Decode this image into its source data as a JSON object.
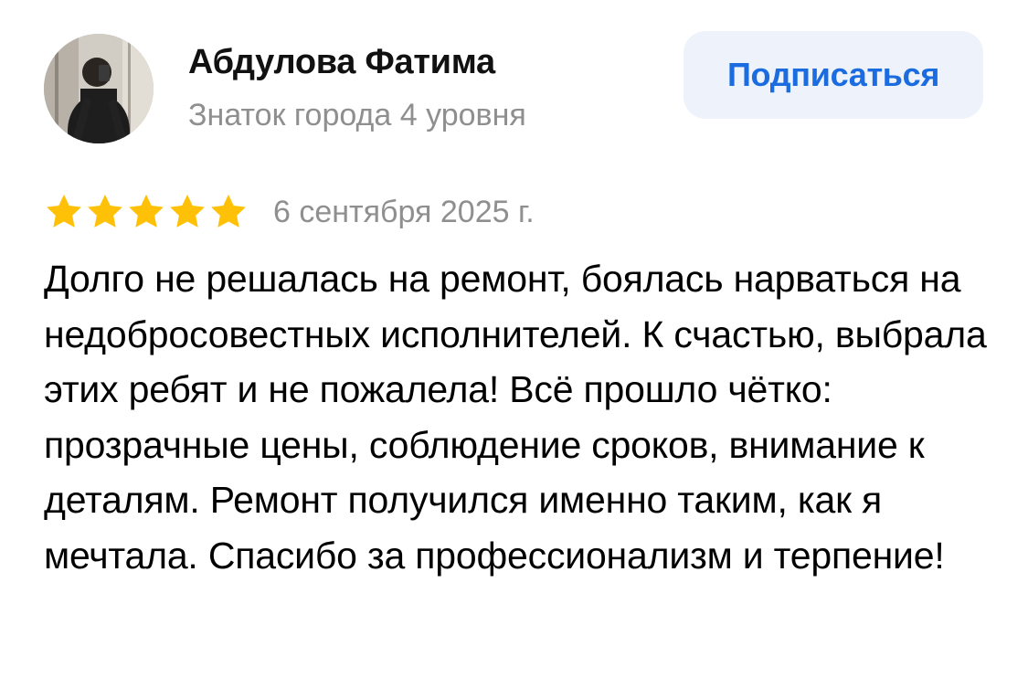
{
  "author": {
    "name": "Абдулова Фатима",
    "level": "Знаток города 4 уровня",
    "avatar": "user-avatar-photo"
  },
  "actions": {
    "subscribe_label": "Подписаться"
  },
  "review": {
    "rating": 5,
    "rating_max": 5,
    "date": "6 сентября 2025 г.",
    "text": "Долго не решалась на ремонт, боялась нарваться на недобросовестных исполнителей. К счастью, выбрала этих ребят и не пожалела! Всё прошло чётко: прозрачные цены, соблюдение сроков, внимание к деталям. Ремонт получился именно таким, как я мечтала. Спасибо за профессионализм и терпение!"
  },
  "colors": {
    "accent": "#1a6ce0",
    "button_bg": "#eef3fb",
    "star": "#ffc107",
    "muted_text": "#8f8f8f"
  },
  "icons": {
    "star": "star-icon"
  }
}
